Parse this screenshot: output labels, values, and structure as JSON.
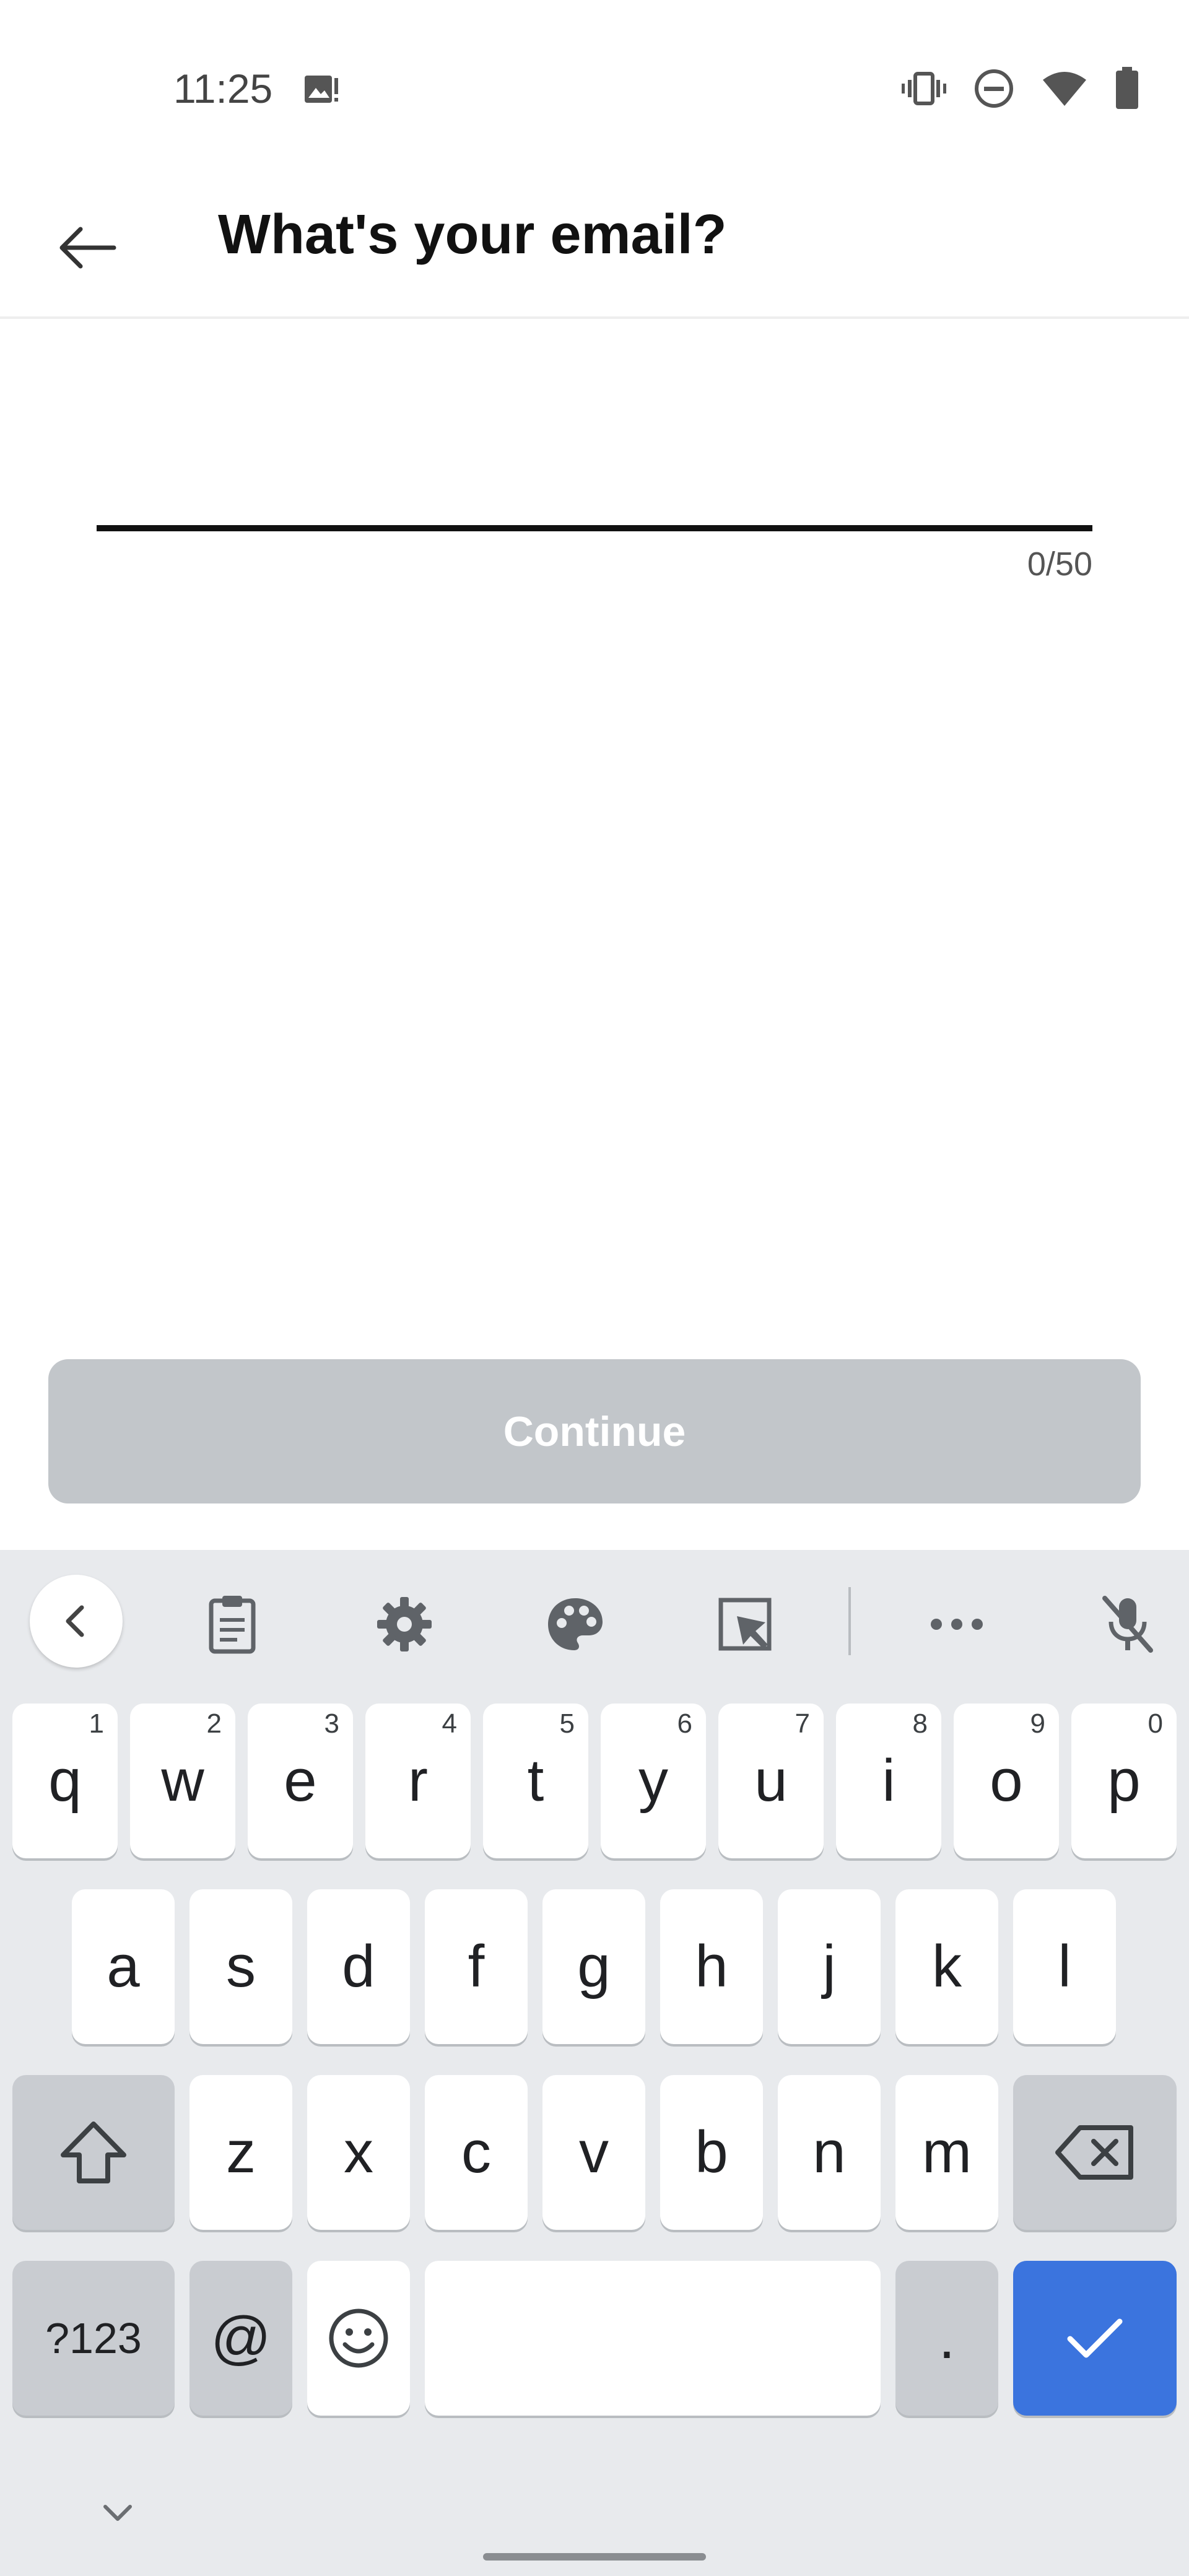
{
  "status_bar": {
    "time": "11:25",
    "icons": [
      "image-alert-icon",
      "vibrate-icon",
      "do-not-disturb-icon",
      "wifi-icon",
      "battery-icon"
    ]
  },
  "app_bar": {
    "back_icon": "arrow-left-icon",
    "title": "What's your email?"
  },
  "form": {
    "email_value": "",
    "char_counter": "0/50"
  },
  "continue_button": {
    "label": "Continue",
    "bg_color": "#c2c6ca",
    "text_color": "#ffffff"
  },
  "keyboard": {
    "toolbar_icons": [
      "chevron-left-icon",
      "clipboard-icon",
      "gear-icon",
      "palette-icon",
      "resize-icon",
      "more-horiz-icon",
      "mic-off-icon"
    ],
    "row1": [
      {
        "label": "q",
        "hint": "1"
      },
      {
        "label": "w",
        "hint": "2"
      },
      {
        "label": "e",
        "hint": "3"
      },
      {
        "label": "r",
        "hint": "4"
      },
      {
        "label": "t",
        "hint": "5"
      },
      {
        "label": "y",
        "hint": "6"
      },
      {
        "label": "u",
        "hint": "7"
      },
      {
        "label": "i",
        "hint": "8"
      },
      {
        "label": "o",
        "hint": "9"
      },
      {
        "label": "p",
        "hint": "0"
      }
    ],
    "row2": [
      "a",
      "s",
      "d",
      "f",
      "g",
      "h",
      "j",
      "k",
      "l"
    ],
    "row3": [
      "z",
      "x",
      "c",
      "v",
      "b",
      "n",
      "m"
    ],
    "row4": {
      "symbols": "?123",
      "at": "@",
      "period": "."
    },
    "enter_color": "#3b74de"
  }
}
